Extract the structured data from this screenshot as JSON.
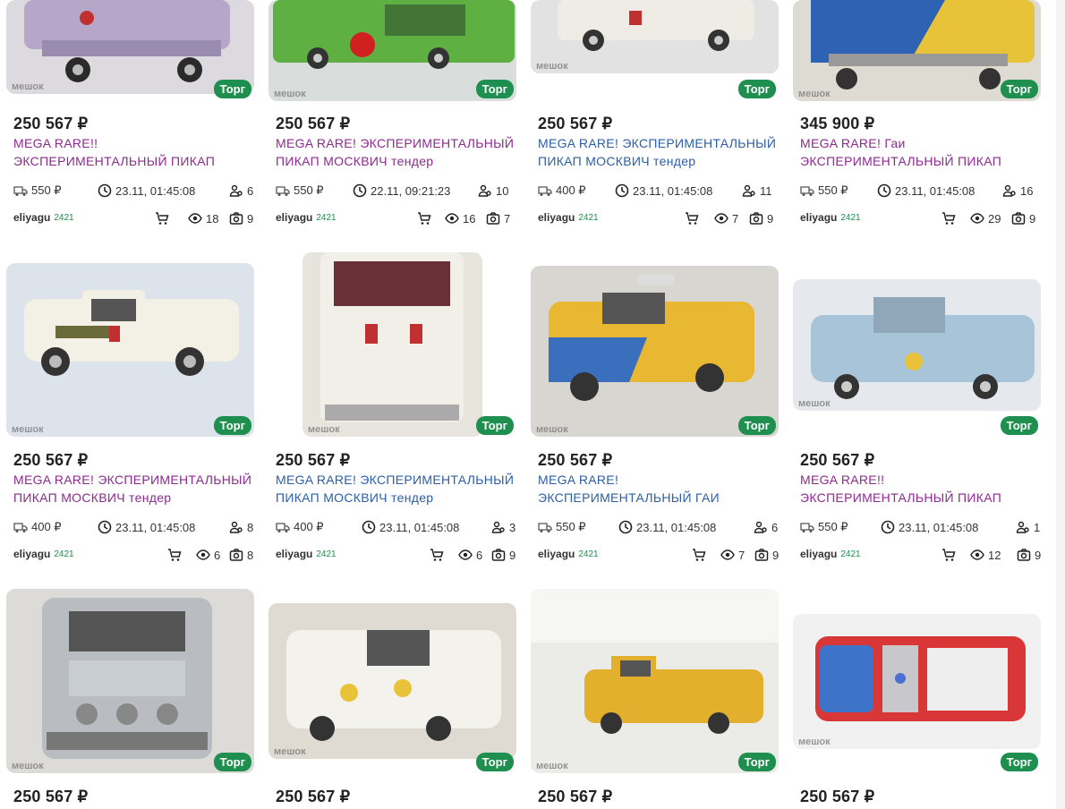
{
  "badge_label": "Торг",
  "watermark": "мешок",
  "cards": [
    {
      "price": "250 567 ₽",
      "title1": "MEGA RARE!!",
      "title2": "ЭКСПЕРИМЕНТАЛЬНЫЙ ПИКАП",
      "title_color": "purple",
      "delivery": "550 ₽",
      "time": "23.11, 01:45:08",
      "bids": "6",
      "seller": "eliyagu",
      "rating": "2421",
      "views": "18",
      "photos": "9"
    },
    {
      "price": "250 567 ₽",
      "title1": "MEGA RARE! ЭКСПЕРИМЕНТАЛЬНЫЙ",
      "title2": "ПИКАП МОСКВИЧ тендер",
      "title_color": "purple",
      "delivery": "550 ₽",
      "time": "22.11, 09:21:23",
      "bids": "10",
      "seller": "eliyagu",
      "rating": "2421",
      "views": "16",
      "photos": "7"
    },
    {
      "price": "250 567 ₽",
      "title1": "MEGA RARE! ЭКСПЕРИМЕНТАЛЬНЫЙ",
      "title2": "ПИКАП МОСКВИЧ тендер",
      "title_color": "blue",
      "delivery": "400 ₽",
      "time": "23.11, 01:45:08",
      "bids": "11",
      "seller": "eliyagu",
      "rating": "2421",
      "views": "7",
      "photos": "9"
    },
    {
      "price": "345 900 ₽",
      "title1": "MEGA RARE! Гаи",
      "title2": "ЭКСПЕРИМЕНТАЛЬНЫЙ ПИКАП",
      "title_color": "purple",
      "delivery": "550 ₽",
      "time": "23.11, 01:45:08",
      "bids": "16",
      "seller": "eliyagu",
      "rating": "2421",
      "views": "29",
      "photos": "9"
    },
    {
      "price": "250 567 ₽",
      "title1": "MEGA RARE! ЭКСПЕРИМЕНТАЛЬНЫЙ",
      "title2": "ПИКАП МОСКВИЧ тендер",
      "title_color": "purple",
      "delivery": "400 ₽",
      "time": "23.11, 01:45:08",
      "bids": "8",
      "seller": "eliyagu",
      "rating": "2421",
      "views": "6",
      "photos": "8"
    },
    {
      "price": "250 567 ₽",
      "title1": "MEGA RARE! ЭКСПЕРИМЕНТАЛЬНЫЙ",
      "title2": "ПИКАП МОСКВИЧ тендер",
      "title_color": "blue",
      "delivery": "400 ₽",
      "time": "23.11, 01:45:08",
      "bids": "3",
      "seller": "eliyagu",
      "rating": "2421",
      "views": "6",
      "photos": "9"
    },
    {
      "price": "250 567 ₽",
      "title1": "MEGA RARE!",
      "title2": "ЭКСПЕРИМЕНТАЛЬНЫЙ ГАИ",
      "title_color": "blue",
      "delivery": "550 ₽",
      "time": "23.11, 01:45:08",
      "bids": "6",
      "seller": "eliyagu",
      "rating": "2421",
      "views": "7",
      "photos": "9"
    },
    {
      "price": "250 567 ₽",
      "title1": "MEGA RARE!!",
      "title2": "ЭКСПЕРИМЕНТАЛЬНЫЙ ПИКАП",
      "title_color": "purple",
      "delivery": "550 ₽",
      "time": "23.11, 01:45:08",
      "bids": "1",
      "seller": "eliyagu",
      "rating": "2421",
      "views": "12",
      "photos": "9"
    },
    {
      "price": "250 567 ₽"
    },
    {
      "price": "250 567 ₽"
    },
    {
      "price": "250 567 ₽"
    },
    {
      "price": "250 567 ₽"
    }
  ],
  "colors": {
    "badge": "#1e8f4e",
    "title_purple": "#8d2a8f",
    "title_blue": "#2b5ea8"
  }
}
